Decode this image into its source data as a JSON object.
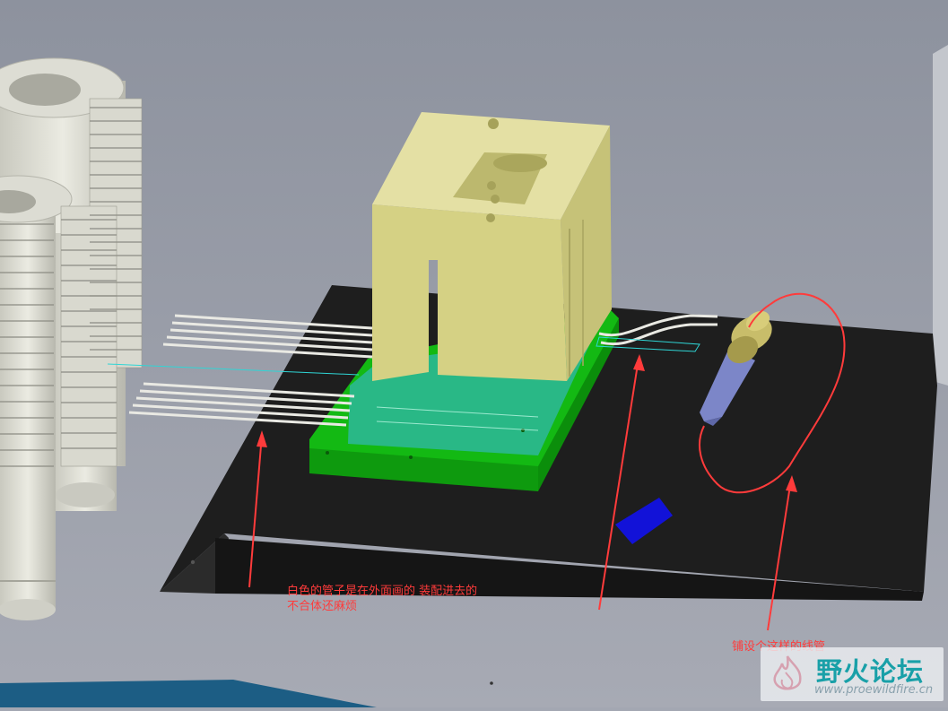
{
  "annotations": {
    "pipes_note_line1": "白色的管子是在外面画的 装配进去的",
    "pipes_note_line2": "不合体还麻烦",
    "wire_note": "铺设个这样的线管"
  },
  "watermark": {
    "title": "野火论坛",
    "url": "www.proewildfire.cn"
  },
  "colors": {
    "background": "#a3a7b2",
    "annotation": "#ff3b3b",
    "plate": "#1d1d1d",
    "green_base": "#14c414",
    "mold_block": "#d8d48c",
    "heat_sink": "#cfcfc6",
    "connector": "#7c86c8",
    "clip": "#1010d8"
  },
  "icons": {
    "logo": "flame-icon"
  }
}
